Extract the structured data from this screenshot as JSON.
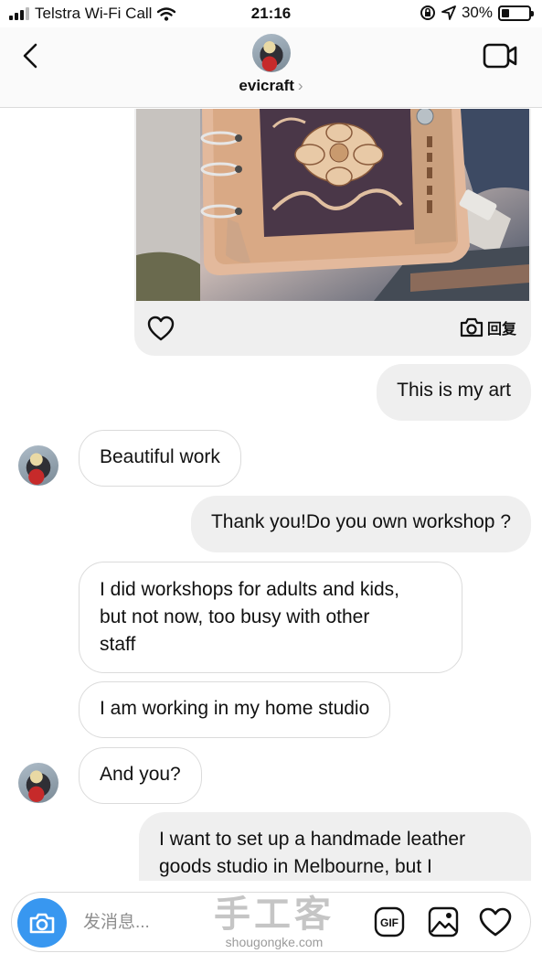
{
  "status_bar": {
    "carrier": "Telstra Wi-Fi Call",
    "time": "21:16",
    "battery_percent": "30%",
    "battery_level": 0.3,
    "icons": [
      "signal-icon",
      "wifi-icon",
      "orientation-lock-icon",
      "location-icon",
      "battery-icon"
    ]
  },
  "header": {
    "username": "evicraft",
    "chevron": "›",
    "icons": {
      "back": "chevron-left-icon",
      "video": "video-camera-icon"
    }
  },
  "media_card": {
    "reply_label": "回复",
    "icons": {
      "like": "heart-icon",
      "reply": "camera-icon"
    }
  },
  "messages": [
    {
      "side": "out",
      "text": "This is my art"
    },
    {
      "side": "in",
      "text": "Beautiful work",
      "avatar": true
    },
    {
      "side": "out",
      "text": "Thank you!Do you own workshop ?"
    },
    {
      "side": "in",
      "lines": [
        "I did workshops for adults and kids,",
        "but not now, too busy with other",
        "staff"
      ]
    },
    {
      "side": "in",
      "text": "I am working in my home studio"
    },
    {
      "side": "in",
      "text": "And you?",
      "avatar": true
    },
    {
      "side": "out",
      "lines": [
        "I want to set up a handmade leather",
        "goods studio in Melbourne, but I"
      ]
    }
  ],
  "composer": {
    "placeholder": "发消息...",
    "gif_label": "GIF",
    "icons": {
      "camera": "camera-icon",
      "gif": "gif-icon",
      "gallery": "image-gallery-icon",
      "like": "heart-icon"
    }
  },
  "watermark": {
    "title": "手工客",
    "url": "shougongke.com"
  },
  "colors": {
    "accent": "#3897f0",
    "bubble_out": "#efefef",
    "bubble_in_border": "#dbdbdb",
    "header_bg": "#fafafa"
  }
}
